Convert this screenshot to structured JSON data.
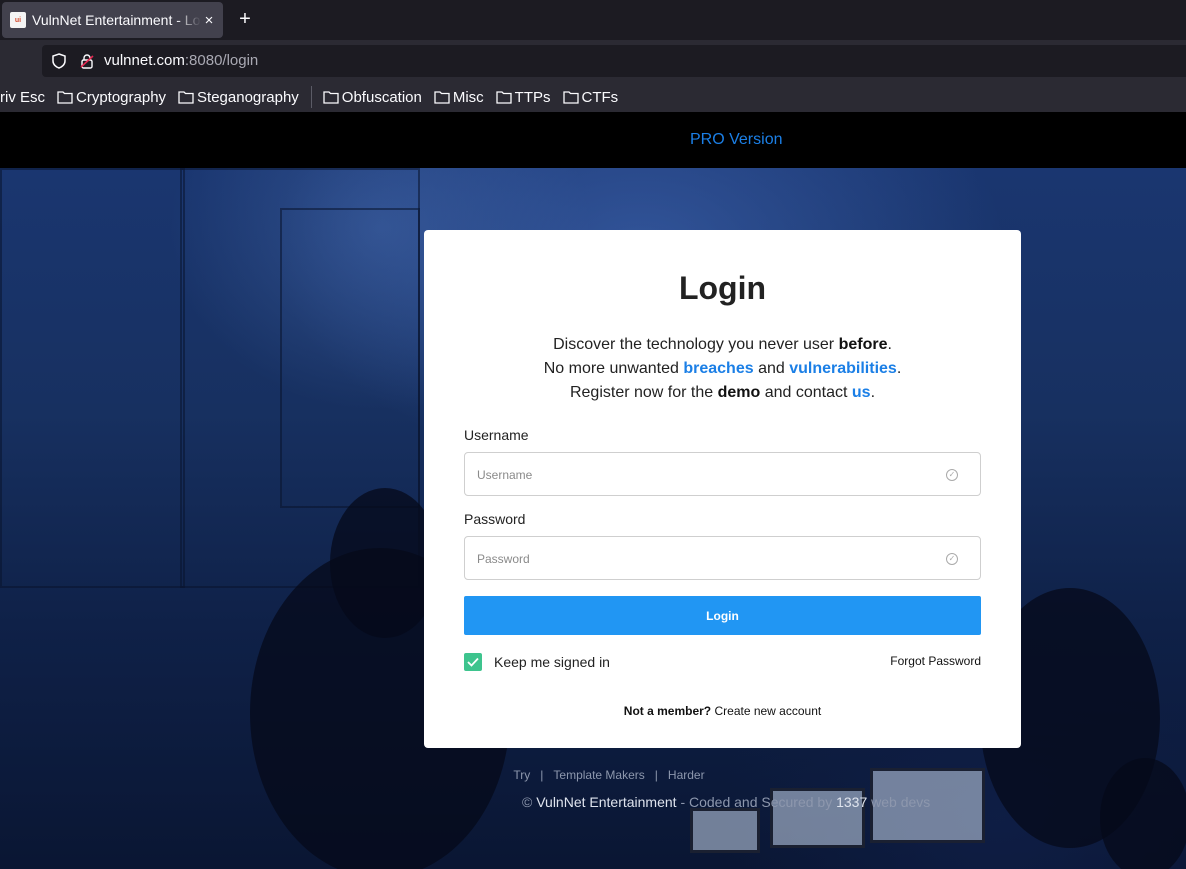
{
  "browser": {
    "tab_title": "VulnNet Entertainment - Login",
    "tab_close": "×",
    "new_tab": "+",
    "url_host": "vulnnet.com",
    "url_rest": ":8080/login"
  },
  "bookmarks": [
    "riv Esc",
    "Cryptography",
    "Steganography",
    "Obfuscation",
    "Misc",
    "TTPs",
    "CTFs"
  ],
  "header": {
    "pro_link": "PRO Version"
  },
  "login": {
    "title": "Login",
    "intro_line1_a": "Discover the technology you never user ",
    "intro_line1_b": "before",
    "intro_line1_c": ".",
    "intro_line2_a": "No more unwanted ",
    "intro_line2_b": "breaches",
    "intro_line2_c": " and ",
    "intro_line2_d": "vulnerabilities",
    "intro_line2_e": ".",
    "intro_line3_a": "Register now for the ",
    "intro_line3_b": "demo",
    "intro_line3_c": " and contact ",
    "intro_line3_d": "us",
    "intro_line3_e": ".",
    "username_label": "Username",
    "username_placeholder": "Username",
    "password_label": "Password",
    "password_placeholder": "Password",
    "button_label": "Login",
    "keep_signed_in": "Keep me signed in",
    "keep_checked": true,
    "forgot_password": "Forgot Password",
    "not_member": "Not a member?",
    "create_account": "Create new account"
  },
  "footer": {
    "links": [
      "Try",
      "Template Makers",
      "Harder"
    ],
    "copyright_prefix": "© ",
    "brand": "VulnNet Entertainment",
    "middle": " - Coded and Secured by ",
    "number": "1337",
    "suffix": " web devs"
  },
  "colors": {
    "accent": "#2196f3",
    "link": "#1b7fe6",
    "check": "#3ec48e",
    "header": "#000000"
  }
}
